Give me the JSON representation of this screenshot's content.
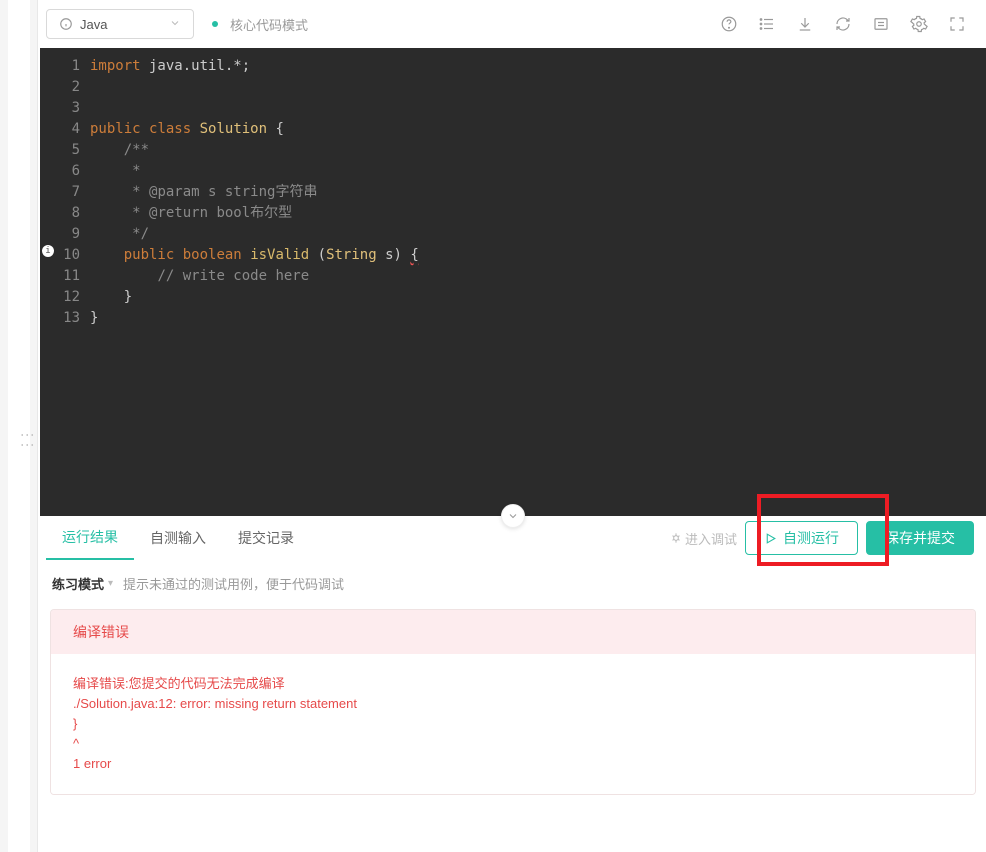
{
  "toolbar": {
    "language": "Java",
    "mode_label": "核心代码模式"
  },
  "code": [
    {
      "n": 1,
      "tokens": [
        [
          "kw",
          "import"
        ],
        [
          "txt",
          " java.util.*;"
        ]
      ]
    },
    {
      "n": 2,
      "tokens": []
    },
    {
      "n": 3,
      "tokens": []
    },
    {
      "n": 4,
      "tokens": [
        [
          "kw",
          "public"
        ],
        [
          "txt",
          " "
        ],
        [
          "kw",
          "class"
        ],
        [
          "txt",
          " "
        ],
        [
          "type",
          "Solution"
        ],
        [
          "txt",
          " {"
        ]
      ]
    },
    {
      "n": 5,
      "tokens": [
        [
          "txt",
          "    "
        ],
        [
          "com",
          "/**"
        ]
      ]
    },
    {
      "n": 6,
      "tokens": [
        [
          "txt",
          "     "
        ],
        [
          "com",
          "* "
        ]
      ]
    },
    {
      "n": 7,
      "tokens": [
        [
          "txt",
          "     "
        ],
        [
          "com",
          "* @param s string字符串 "
        ]
      ]
    },
    {
      "n": 8,
      "tokens": [
        [
          "txt",
          "     "
        ],
        [
          "com",
          "* @return bool布尔型"
        ]
      ]
    },
    {
      "n": 9,
      "tokens": [
        [
          "txt",
          "     "
        ],
        [
          "com",
          "*/"
        ]
      ]
    },
    {
      "n": 10,
      "tokens": [
        [
          "txt",
          "    "
        ],
        [
          "kw",
          "public"
        ],
        [
          "txt",
          " "
        ],
        [
          "kw",
          "boolean"
        ],
        [
          "txt",
          " "
        ],
        [
          "fn",
          "isValid"
        ],
        [
          "txt",
          " ("
        ],
        [
          "type",
          "String"
        ],
        [
          "txt",
          " s) "
        ],
        [
          "err",
          "{"
        ]
      ]
    },
    {
      "n": 11,
      "tokens": [
        [
          "txt",
          "        "
        ],
        [
          "com",
          "// write code here"
        ]
      ]
    },
    {
      "n": 12,
      "tokens": [
        [
          "txt",
          "    }"
        ]
      ]
    },
    {
      "n": 13,
      "tokens": [
        [
          "txt",
          "}"
        ]
      ]
    }
  ],
  "tabs": [
    {
      "key": "result",
      "label": "运行结果",
      "active": true
    },
    {
      "key": "input",
      "label": "自测输入",
      "active": false
    },
    {
      "key": "history",
      "label": "提交记录",
      "active": false
    }
  ],
  "actions": {
    "debug_link": "进入调试",
    "run_btn": "自测运行",
    "submit_btn": "保存并提交"
  },
  "practice_mode": {
    "title": "练习模式",
    "hint": "提示未通过的测试用例，便于代码调试"
  },
  "error_panel": {
    "title": "编译错误",
    "body": "编译错误:您提交的代码无法完成编译\n./Solution.java:12: error: missing return statement\n}\n^\n1 error"
  }
}
